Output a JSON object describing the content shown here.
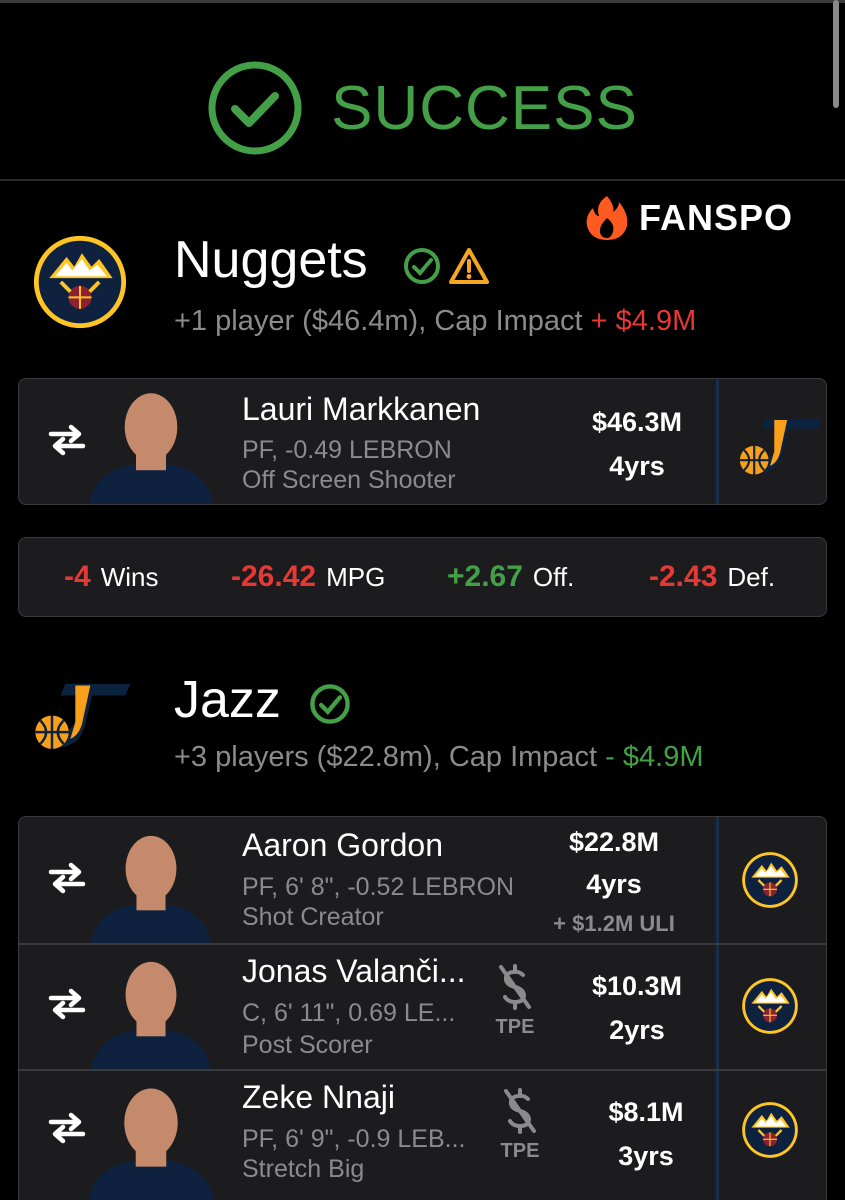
{
  "banner": {
    "status": "SUCCESS",
    "brand": "FANSPO"
  },
  "colors": {
    "success": "#43a047",
    "negative": "#e53935",
    "muted": "#8b8b8b",
    "card": "#1c1c1e",
    "warning": "#f5a623"
  },
  "nuggets": {
    "name": "Nuggets",
    "summary": "+1 player ($46.4m), Cap Impact ",
    "impact": "+ $4.9M",
    "players": [
      {
        "name": "Lauri Markkanen",
        "line1": "PF, -0.49 LEBRON",
        "line2": "Off Screen Shooter",
        "salary": "$46.3M",
        "years": "4yrs",
        "from_team_icon": "jazz-logo"
      }
    ],
    "stats": [
      {
        "value": "-4",
        "label": "Wins"
      },
      {
        "value": "-26.42",
        "label": "MPG"
      },
      {
        "value": "+2.67",
        "label": "Off."
      },
      {
        "value": "-2.43",
        "label": "Def."
      }
    ]
  },
  "jazz": {
    "name": "Jazz",
    "summary": "+3 players ($22.8m), Cap Impact ",
    "impact": "- $4.9M",
    "players": [
      {
        "name": "Aaron Gordon",
        "line1": "PF, 6' 8\", -0.52 LEBRON",
        "line2": "Shot Creator",
        "salary": "$22.8M",
        "years": "4yrs",
        "extra": "+ $1.2M ULI",
        "from_team_icon": "nuggets-logo"
      },
      {
        "name": "Jonas Valanči...",
        "line1": "C, 6' 11\", 0.69 LE...",
        "line2": "Post Scorer",
        "salary": "$10.3M",
        "years": "2yrs",
        "tpe": "TPE",
        "from_team_icon": "nuggets-logo"
      },
      {
        "name": "Zeke Nnaji",
        "line1": "PF, 6' 9\", -0.9 LEB...",
        "line2": "Stretch Big",
        "salary": "$8.1M",
        "years": "3yrs",
        "tpe": "TPE",
        "from_team_icon": "nuggets-logo"
      }
    ]
  }
}
